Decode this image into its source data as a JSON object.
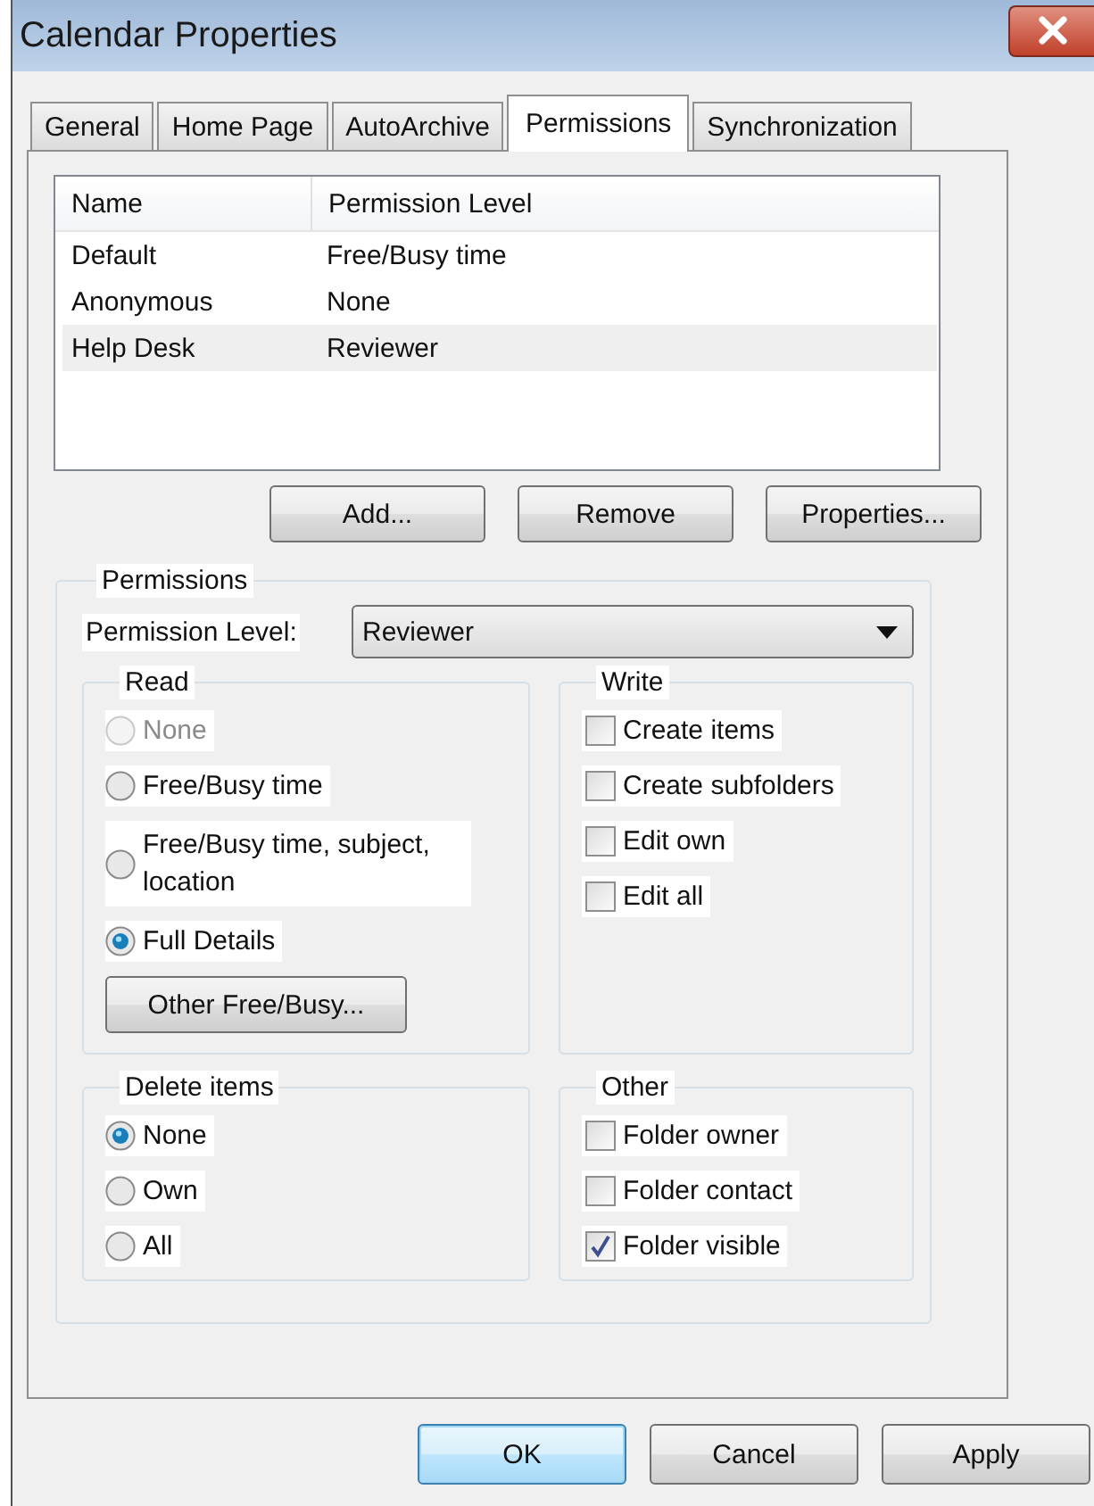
{
  "window": {
    "title": "Calendar Properties"
  },
  "tabs": [
    {
      "label": "General",
      "selected": false
    },
    {
      "label": "Home Page",
      "selected": false
    },
    {
      "label": "AutoArchive",
      "selected": false
    },
    {
      "label": "Permissions",
      "selected": true
    },
    {
      "label": "Synchronization",
      "selected": false
    }
  ],
  "permissions_list": {
    "columns": [
      "Name",
      "Permission Level"
    ],
    "rows": [
      {
        "name": "Default",
        "level": "Free/Busy time",
        "selected": false
      },
      {
        "name": "Anonymous",
        "level": "None",
        "selected": false
      },
      {
        "name": "Help Desk",
        "level": "Reviewer",
        "selected": true
      }
    ]
  },
  "list_buttons": [
    "Add...",
    "Remove",
    "Properties..."
  ],
  "permissions": {
    "title": "Permissions",
    "permission_level": {
      "label": "Permission Level:",
      "value": "Reviewer"
    },
    "read": {
      "title": "Read",
      "options": [
        {
          "label": "None",
          "selected": false,
          "disabled": true
        },
        {
          "label": "Free/Busy time",
          "selected": false,
          "disabled": false
        },
        {
          "label": "Free/Busy time, subject, location",
          "selected": false,
          "disabled": false
        },
        {
          "label": "Full Details",
          "selected": true,
          "disabled": false
        }
      ],
      "button": "Other Free/Busy..."
    },
    "write": {
      "title": "Write",
      "options": [
        {
          "label": "Create items",
          "checked": false
        },
        {
          "label": "Create subfolders",
          "checked": false
        },
        {
          "label": "Edit own",
          "checked": false
        },
        {
          "label": "Edit all",
          "checked": false
        }
      ]
    },
    "delete_items": {
      "title": "Delete items",
      "options": [
        {
          "label": "None",
          "selected": true,
          "disabled": false
        },
        {
          "label": "Own",
          "selected": false,
          "disabled": false
        },
        {
          "label": "All",
          "selected": false,
          "disabled": false
        }
      ]
    },
    "other": {
      "title": "Other",
      "options": [
        {
          "label": "Folder owner",
          "checked": false
        },
        {
          "label": "Folder contact",
          "checked": false
        },
        {
          "label": "Folder visible",
          "checked": true
        }
      ]
    }
  },
  "buttons": [
    {
      "label": "OK",
      "default": true
    },
    {
      "label": "Cancel",
      "default": false
    },
    {
      "label": "Apply",
      "default": false
    }
  ]
}
